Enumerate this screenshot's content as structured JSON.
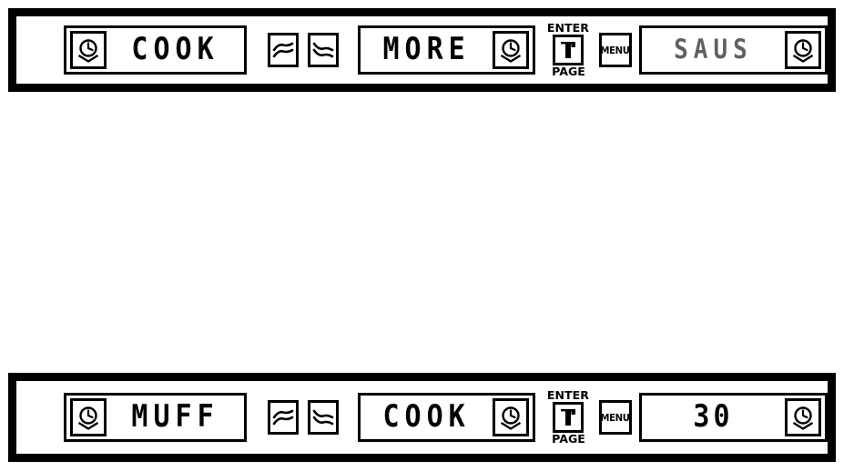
{
  "figure": {
    "type": "appliance-control-panel-display-sequence",
    "ink_color": "#000000",
    "background_color": "#ffffff"
  },
  "rows": [
    {
      "name": "top-panel",
      "displays": [
        {
          "name": "display-left",
          "text": "COOK",
          "clock_icon_side": "left",
          "icon": "clock-icon",
          "faint": false
        },
        {
          "name": "display-center",
          "text": "MORE",
          "clock_icon_side": "right",
          "icon": "clock-icon",
          "faint": false
        },
        {
          "name": "display-right",
          "text": "SAUS",
          "clock_icon_side": "right",
          "icon": "clock-icon",
          "faint": true
        }
      ],
      "chevrons": {
        "up": "chevron-double-up-icon",
        "down": "chevron-double-down-icon"
      },
      "enter_page": {
        "top_label": "ENTER",
        "bottom_label": "PAGE",
        "icon": "page-enter-icon"
      },
      "menu": {
        "label": "MENU"
      }
    },
    {
      "name": "bottom-panel",
      "displays": [
        {
          "name": "display-left",
          "text": "MUFF",
          "clock_icon_side": "left",
          "icon": "clock-icon",
          "faint": false
        },
        {
          "name": "display-center",
          "text": "COOK",
          "clock_icon_side": "right",
          "icon": "clock-icon",
          "faint": false
        },
        {
          "name": "display-right",
          "text": "30",
          "clock_icon_side": "right",
          "icon": "clock-icon",
          "faint": false
        }
      ],
      "chevrons": {
        "up": "chevron-double-up-icon",
        "down": "chevron-double-down-icon"
      },
      "enter_page": {
        "top_label": "ENTER",
        "bottom_label": "PAGE",
        "icon": "page-enter-icon"
      },
      "menu": {
        "label": "MENU"
      }
    }
  ]
}
